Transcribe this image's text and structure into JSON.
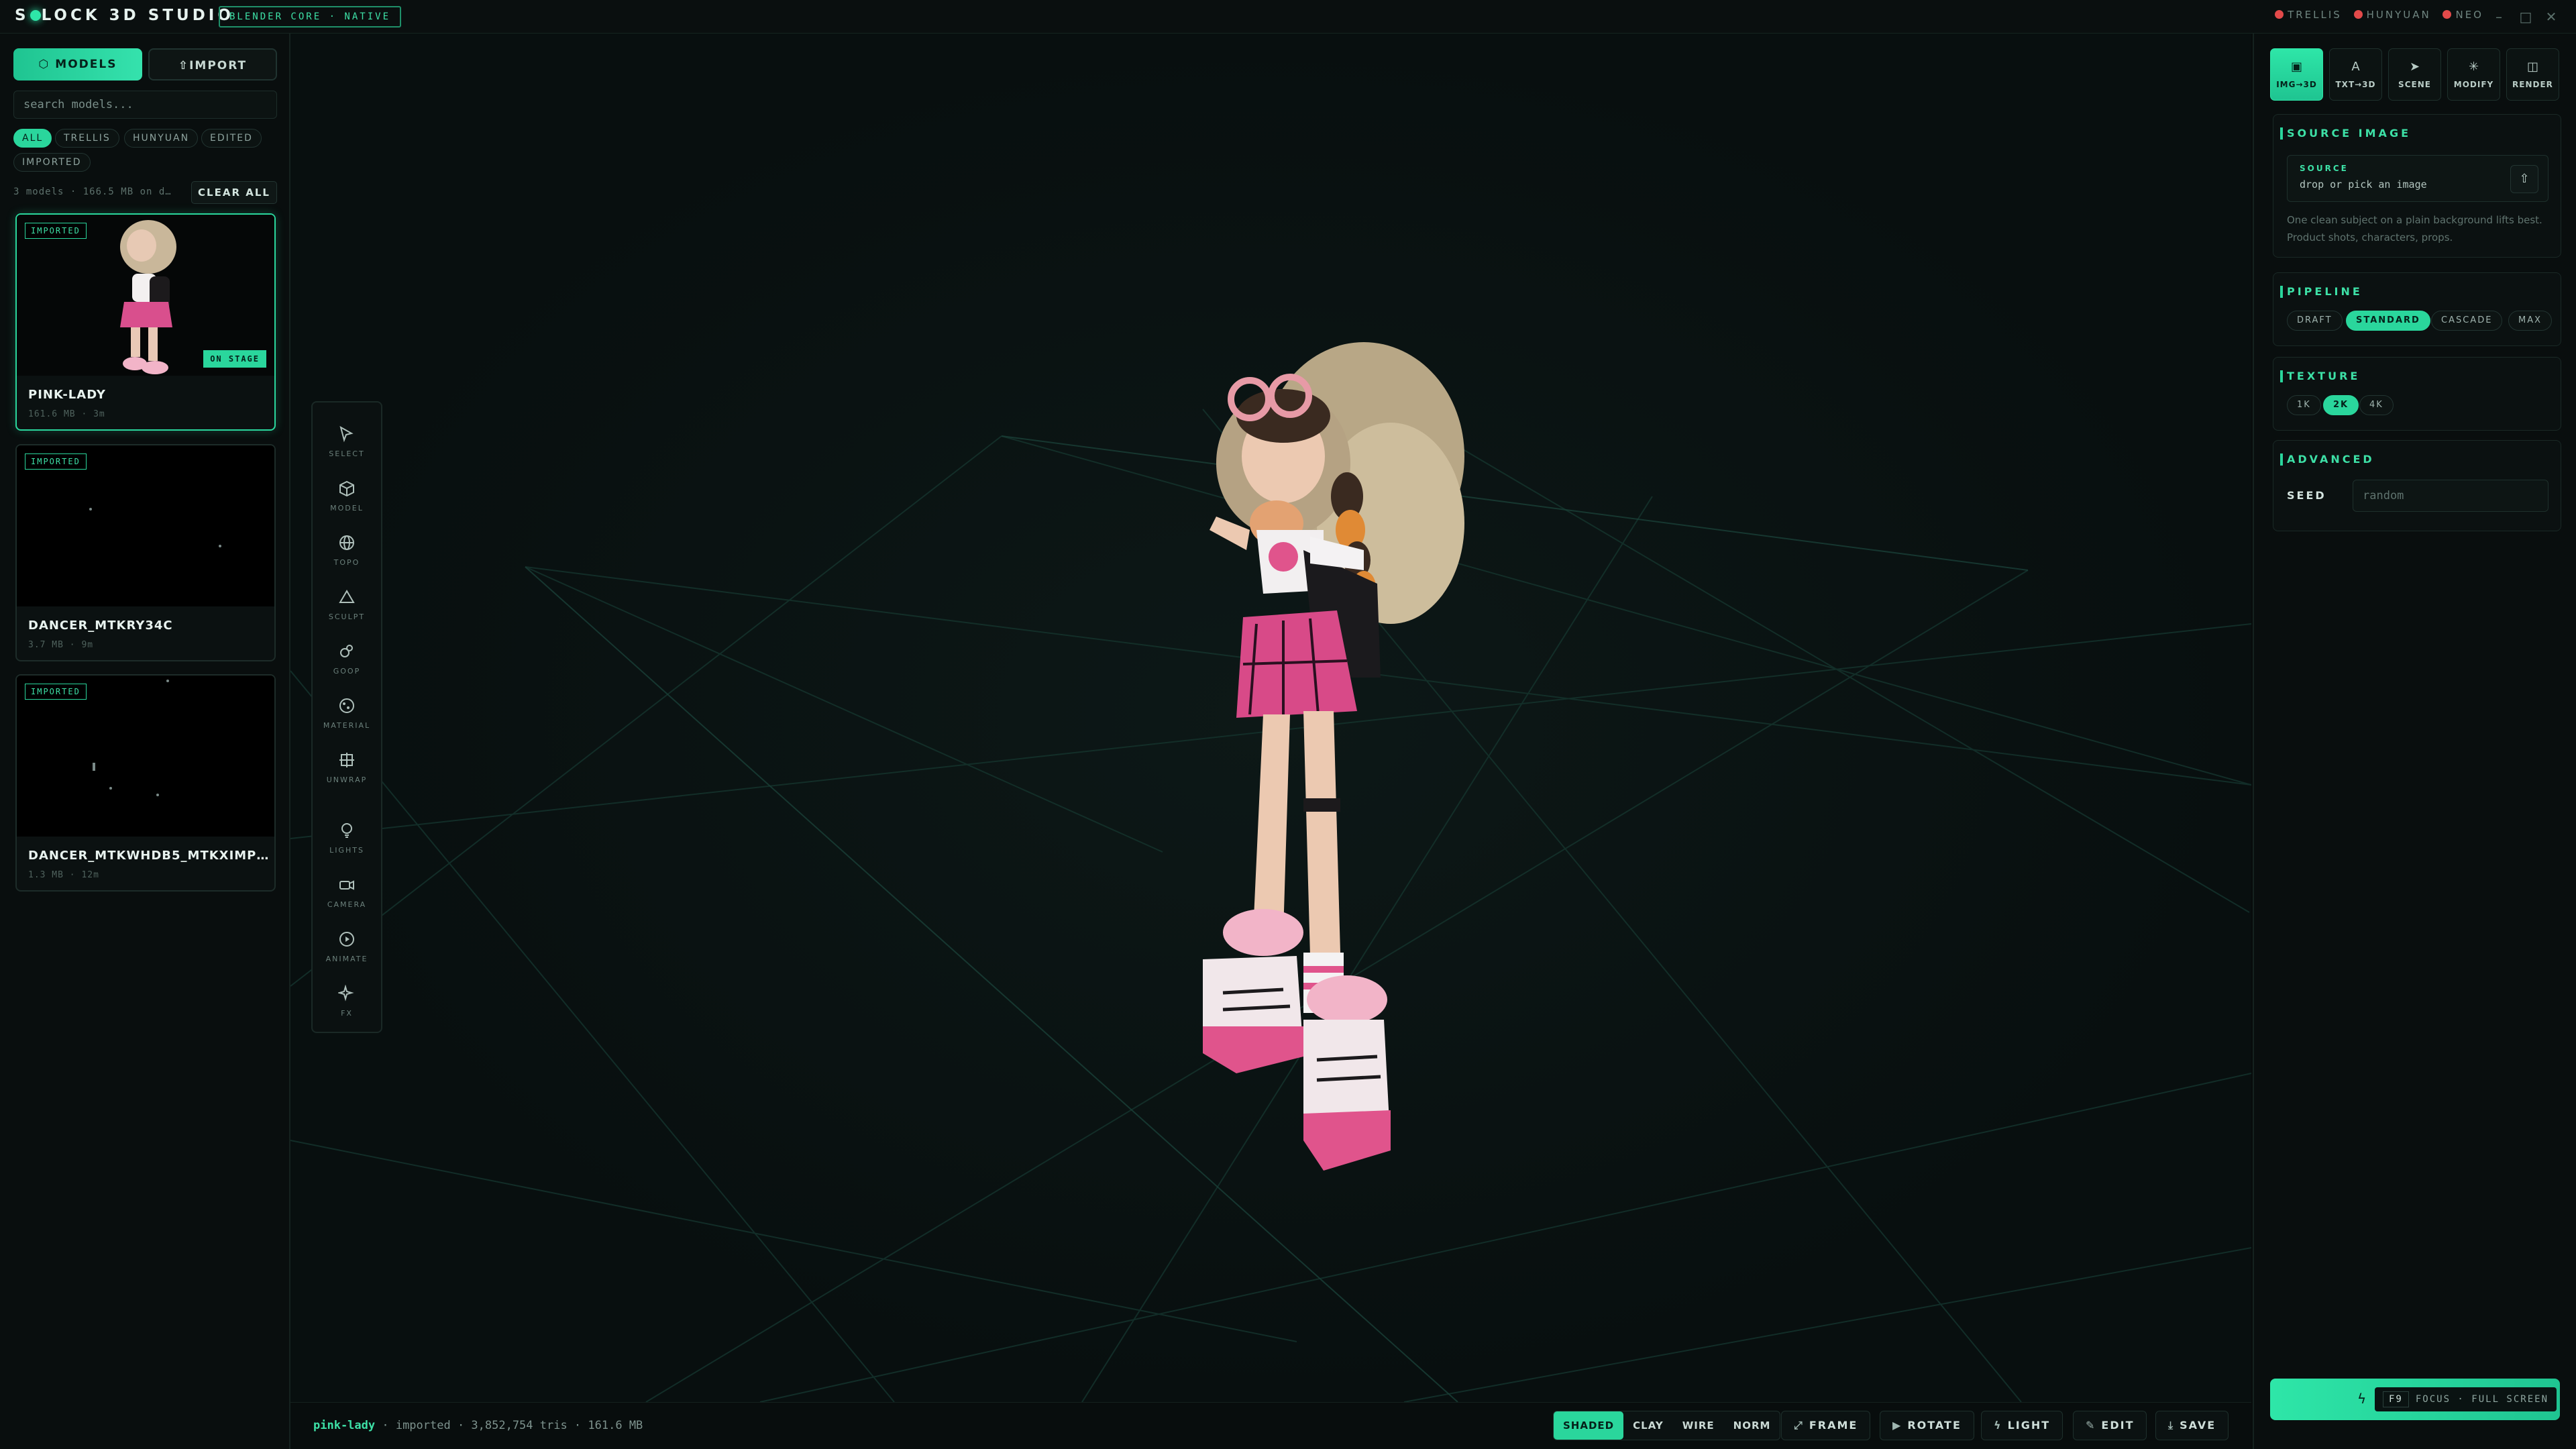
{
  "app": {
    "title_pre": "S",
    "title_post": "LOCK 3D STUDIO",
    "core_badge": "BLENDER CORE · NATIVE",
    "status": [
      {
        "label": "TRELLIS",
        "color": "#e24a4a"
      },
      {
        "label": "HUNYUAN",
        "color": "#e24a4a"
      },
      {
        "label": "NEO",
        "color": "#e24a4a"
      }
    ],
    "window_controls": [
      "–",
      "□",
      "✕"
    ]
  },
  "sidebar": {
    "tabs": [
      {
        "label": "MODELS",
        "icon": "cube-icon",
        "active": true
      },
      {
        "label": "IMPORT",
        "icon": "upload-icon",
        "active": false
      }
    ],
    "search_placeholder": "search models...",
    "filters": [
      {
        "label": "ALL",
        "active": true
      },
      {
        "label": "TRELLIS",
        "active": false
      },
      {
        "label": "HUNYUAN",
        "active": false
      },
      {
        "label": "EDITED",
        "active": false
      },
      {
        "label": "IMPORTED",
        "active": false
      }
    ],
    "info": "3 models · 166.5 MB on d…",
    "clear_all": "CLEAR ALL",
    "models": [
      {
        "name": "PINK-LADY",
        "meta": "161.6 MB · 3m",
        "badge": "IMPORTED",
        "stage": "ON STAGE",
        "selected": true
      },
      {
        "name": "DANCER_MTKRY34C",
        "meta": "3.7 MB · 9m",
        "badge": "IMPORTED",
        "selected": false
      },
      {
        "name": "DANCER_MTKWHDB5_MTKXIMP4_…",
        "meta": "1.3 MB · 12m",
        "badge": "IMPORTED",
        "selected": false
      }
    ]
  },
  "tools": [
    {
      "label": "SELECT",
      "icon": "cursor-icon"
    },
    {
      "label": "MODEL",
      "icon": "cube-icon"
    },
    {
      "label": "TOPO",
      "icon": "globe-icon"
    },
    {
      "label": "SCULPT",
      "icon": "triangle-icon"
    },
    {
      "label": "GOOP",
      "icon": "blob-icon"
    },
    {
      "label": "MATERIAL",
      "icon": "sphere-icon"
    },
    {
      "label": "UNWRAP",
      "icon": "grid-icon"
    },
    {
      "label": "LIGHTS",
      "icon": "bulb-icon"
    },
    {
      "label": "CAMERA",
      "icon": "camera-icon"
    },
    {
      "label": "ANIMATE",
      "icon": "play-icon"
    },
    {
      "label": "FX",
      "icon": "sparkle-icon"
    }
  ],
  "viewport": {
    "stats_name": "pink-lady",
    "stats_rest": " · imported · 3,852,754 tris · 161.6 MB",
    "modes": [
      {
        "label": "SHADED",
        "active": true
      },
      {
        "label": "CLAY",
        "active": false
      },
      {
        "label": "WIRE",
        "active": false
      },
      {
        "label": "NORM",
        "active": false
      }
    ],
    "actions": [
      {
        "label": "FRAME",
        "icon": "expand-icon",
        "glyph": "⤢"
      },
      {
        "label": "ROTATE",
        "icon": "play-icon",
        "glyph": "▶"
      },
      {
        "label": "LIGHT",
        "icon": "bolt-icon",
        "glyph": "ϟ"
      },
      {
        "label": "EDIT",
        "icon": "pencil-icon",
        "glyph": "✎"
      },
      {
        "label": "SAVE",
        "icon": "save-icon",
        "glyph": "⤓"
      }
    ]
  },
  "right": {
    "tabs": [
      {
        "label": "IMG→3D",
        "glyph": "▣",
        "active": true
      },
      {
        "label": "TXT→3D",
        "glyph": "A",
        "active": false
      },
      {
        "label": "SCENE",
        "glyph": "➤",
        "active": false
      },
      {
        "label": "MODIFY",
        "glyph": "✳",
        "active": false
      },
      {
        "label": "RENDER",
        "glyph": "◫",
        "active": false
      }
    ],
    "source": {
      "title": "SOURCE IMAGE",
      "label": "SOURCE",
      "hint": "drop or pick an image",
      "note": "One clean subject on a plain background lifts best. Product shots, characters, props."
    },
    "pipeline": {
      "title": "PIPELINE",
      "options": [
        {
          "label": "DRAFT",
          "active": false
        },
        {
          "label": "STANDARD",
          "active": true
        },
        {
          "label": "CASCADE",
          "active": false
        },
        {
          "label": "MAX",
          "active": false
        }
      ]
    },
    "texture": {
      "title": "TEXTURE",
      "options": [
        {
          "label": "1K",
          "active": false
        },
        {
          "label": "2K",
          "active": true
        },
        {
          "label": "4K",
          "active": false
        }
      ]
    },
    "advanced": {
      "title": "ADVANCED",
      "seed_label": "SEED",
      "seed_placeholder": "random"
    },
    "generate": {
      "key": "F9",
      "hint": "FOCUS · FULL SCREEN"
    }
  }
}
